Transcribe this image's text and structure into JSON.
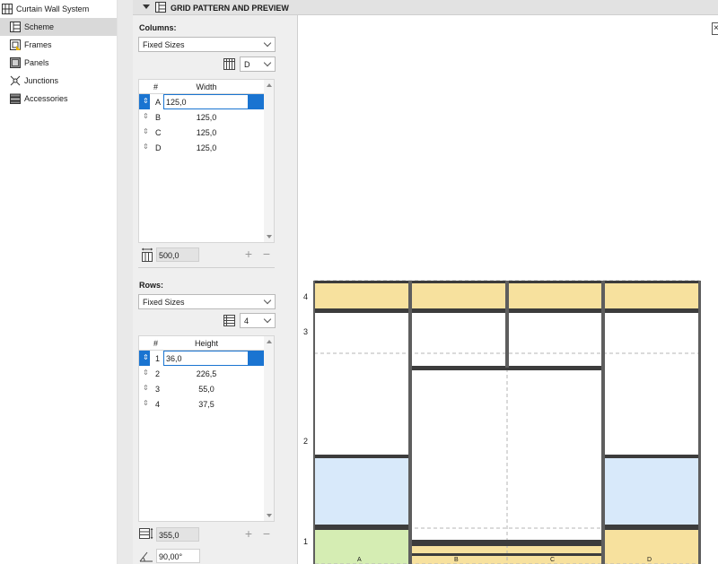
{
  "nav": {
    "root": {
      "label": "Curtain Wall System",
      "icon": "curtain-wall-icon"
    },
    "items": [
      {
        "label": "Scheme",
        "icon": "scheme-icon",
        "active": true
      },
      {
        "label": "Frames",
        "icon": "frames-icon"
      },
      {
        "label": "Panels",
        "icon": "panels-icon"
      },
      {
        "label": "Junctions",
        "icon": "junctions-icon"
      },
      {
        "label": "Accessories",
        "icon": "accessories-icon"
      }
    ]
  },
  "section": {
    "title": "GRID PATTERN AND PREVIEW"
  },
  "columns": {
    "label": "Columns:",
    "mode": "Fixed Sizes",
    "reference": "D",
    "header_num": "#",
    "header_value": "Width",
    "rows": [
      {
        "id": "A",
        "value": "125,0"
      },
      {
        "id": "B",
        "value": "125,0"
      },
      {
        "id": "C",
        "value": "125,0"
      },
      {
        "id": "D",
        "value": "125,0"
      }
    ],
    "total": "500,0"
  },
  "rows": {
    "label": "Rows:",
    "mode": "Fixed Sizes",
    "reference": "4",
    "header_num": "#",
    "header_value": "Height",
    "rows": [
      {
        "id": "1",
        "value": "36,0"
      },
      {
        "id": "2",
        "value": "226,5"
      },
      {
        "id": "3",
        "value": "55,0"
      },
      {
        "id": "4",
        "value": "37,5"
      }
    ],
    "total": "355,0"
  },
  "angle": {
    "value": "90,00°"
  },
  "preview": {
    "row_labels": [
      "4",
      "3",
      "2",
      "1"
    ],
    "col_labels": [
      "A",
      "B",
      "C",
      "D"
    ],
    "colors": {
      "yellow": "#f7e19e",
      "blue": "#d8e9fa",
      "green": "#d5edb3",
      "frame": "#3c3c3c",
      "mullion": "#5e5e5e",
      "guide": "#b5b5b5",
      "accent": "#1a74d1"
    }
  },
  "buttons": {
    "add": "+",
    "remove": "−",
    "close": "×"
  }
}
